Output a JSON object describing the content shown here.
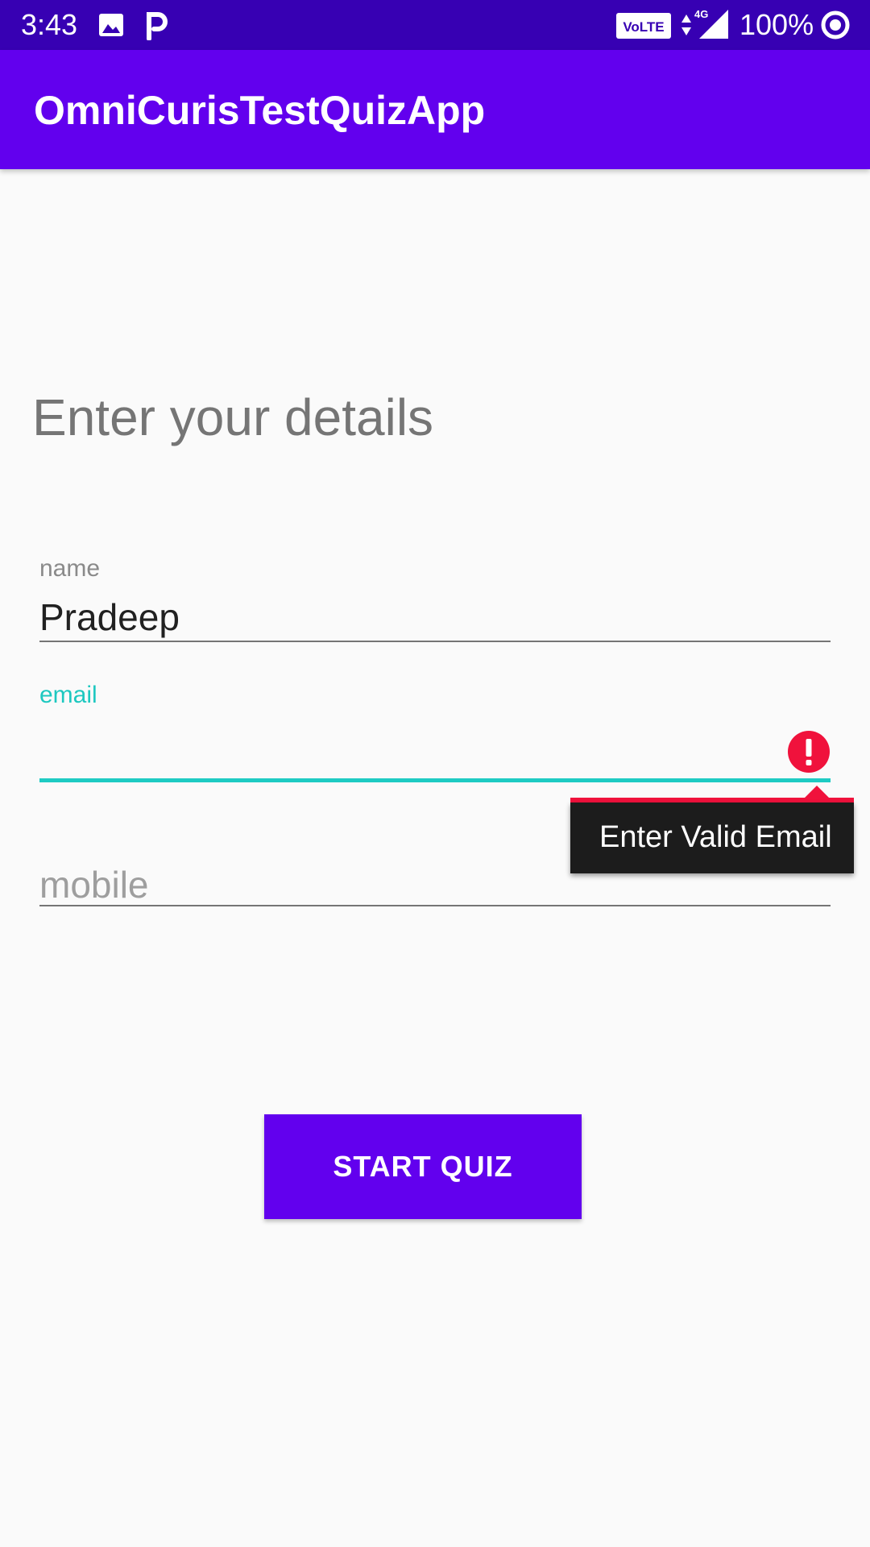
{
  "status_bar": {
    "time": "3:43",
    "battery": "100%",
    "network_type": "4G",
    "volte_label": "VoLTE",
    "icons": [
      "image-icon",
      "parking-icon",
      "volte-icon",
      "data-arrows-icon",
      "signal-icon",
      "ring-icon"
    ]
  },
  "app_bar": {
    "title": "OmniCurisTestQuizApp"
  },
  "form": {
    "heading": "Enter your details",
    "name": {
      "label": "name",
      "value": "Pradeep"
    },
    "email": {
      "label": "email",
      "value": "",
      "error": "Enter Valid Email"
    },
    "mobile": {
      "placeholder": "mobile",
      "value": ""
    }
  },
  "buttons": {
    "start_quiz": "START QUIZ"
  },
  "colors": {
    "status_bar": "#3700b3",
    "primary": "#6200ee",
    "accent": "#1ecbc3",
    "error": "#f0123c",
    "background": "#fafafa"
  }
}
